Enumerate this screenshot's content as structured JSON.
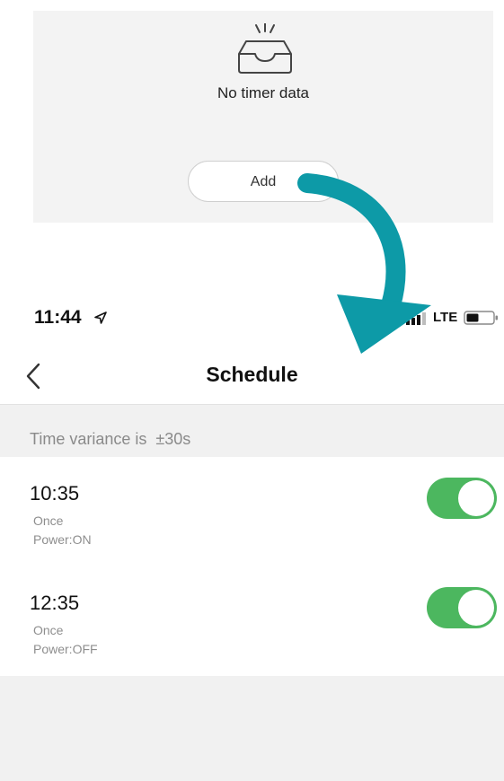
{
  "empty_state": {
    "icon": "empty-inbox-icon",
    "message": "No timer data",
    "add_label": "Add"
  },
  "arrow": {
    "icon": "curved-arrow-icon",
    "color": "#0d9aa7"
  },
  "status_bar": {
    "time": "11:44",
    "location_icon": "location-arrow-icon",
    "signal_icon": "cellular-signal-icon",
    "network": "LTE",
    "battery_icon": "battery-icon"
  },
  "header": {
    "back_icon": "chevron-left-icon",
    "title": "Schedule"
  },
  "variance": {
    "text": "Time variance is  ±30s"
  },
  "schedules": [
    {
      "time": "10:35",
      "repeat": "Once",
      "action": "Power:ON",
      "enabled": true
    },
    {
      "time": "12:35",
      "repeat": "Once",
      "action": "Power:OFF",
      "enabled": true
    }
  ],
  "colors": {
    "toggle_on": "#4cb75f",
    "card_background": "#f3f3f3",
    "section_background": "#f1f1f1"
  }
}
